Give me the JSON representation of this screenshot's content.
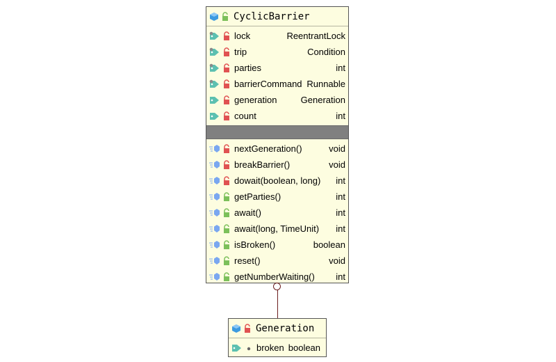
{
  "main_class": {
    "name": "CyclicBarrier",
    "fields": [
      {
        "name": "lock",
        "type": "ReentrantLock",
        "icon": "final-field-icon",
        "visibility": "private"
      },
      {
        "name": "trip",
        "type": "Condition",
        "icon": "final-field-icon",
        "visibility": "private"
      },
      {
        "name": "parties",
        "type": "int",
        "icon": "final-field-icon",
        "visibility": "private"
      },
      {
        "name": "barrierCommand",
        "type": "Runnable",
        "icon": "final-field-icon",
        "visibility": "private"
      },
      {
        "name": "generation",
        "type": "Generation",
        "icon": "field-icon",
        "visibility": "private"
      },
      {
        "name": "count",
        "type": "int",
        "icon": "field-icon",
        "visibility": "private"
      }
    ],
    "methods": [
      {
        "name": "nextGeneration()",
        "type": "void",
        "visibility": "private"
      },
      {
        "name": "breakBarrier()",
        "type": "void",
        "visibility": "private"
      },
      {
        "name": "dowait(boolean, long)",
        "type": "int",
        "visibility": "private"
      },
      {
        "name": "getParties()",
        "type": "int",
        "visibility": "public"
      },
      {
        "name": "await()",
        "type": "int",
        "visibility": "public"
      },
      {
        "name": "await(long, TimeUnit)",
        "type": "int",
        "visibility": "public"
      },
      {
        "name": "isBroken()",
        "type": "boolean",
        "visibility": "public"
      },
      {
        "name": "reset()",
        "type": "void",
        "visibility": "public"
      },
      {
        "name": "getNumberWaiting()",
        "type": "int",
        "visibility": "public"
      }
    ]
  },
  "inner_class": {
    "name": "Generation",
    "fields": [
      {
        "name": "broken",
        "type": "boolean",
        "visibility": "package"
      }
    ]
  },
  "colors": {
    "class_bg": "#fdfde0",
    "private_lock": "#e05252",
    "public_lock": "#7cc05a",
    "class_icon": "#3d9be0",
    "method_icon": "#7aa7f0",
    "field_tag": "#5cc0b0",
    "connector": "#6b1e1e",
    "separator_band": "#808080"
  },
  "connector": {
    "type": "inner-class-nesting"
  }
}
